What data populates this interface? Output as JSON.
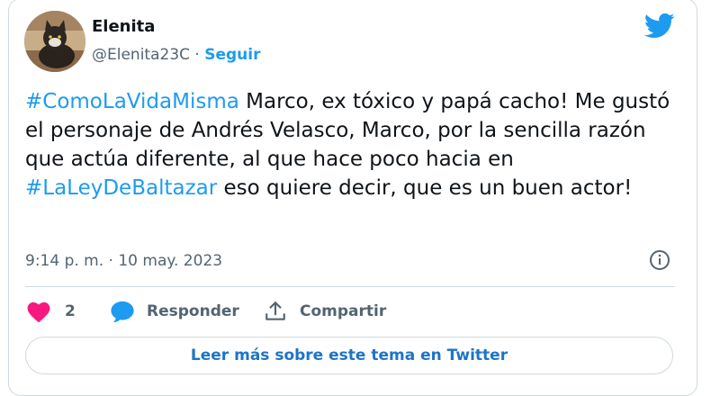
{
  "author": {
    "name": "Elenita",
    "handle": "@Elenita23C",
    "separator": " · ",
    "follow_label": "Seguir"
  },
  "tweet": {
    "hashtag1": "#ComoLaVidaMisma",
    "text1": " Marco, ex tóxico y papá cacho! Me gustó el personaje de Andrés Velasco, Marco, por la sencilla razón que actúa diferente, al que hace poco hacia en ",
    "hashtag2": "#LaLeyDeBaltazar",
    "text2": " eso quiere decir, que es un buen actor!"
  },
  "meta": {
    "timestamp": "9:14 p. m. · 10 may. 2023"
  },
  "actions": {
    "like_count": "2",
    "reply_label": "Responder",
    "share_label": "Compartir"
  },
  "read_more_label": "Leer más sobre este tema en Twitter",
  "colors": {
    "accent": "#1d9bf0",
    "like": "#f91880",
    "muted": "#536471",
    "border": "#cfd9de"
  },
  "icons": [
    "avatar-cat",
    "twitter-bird-icon",
    "info-icon",
    "heart-icon",
    "speech-bubble-icon",
    "share-upload-icon"
  ]
}
